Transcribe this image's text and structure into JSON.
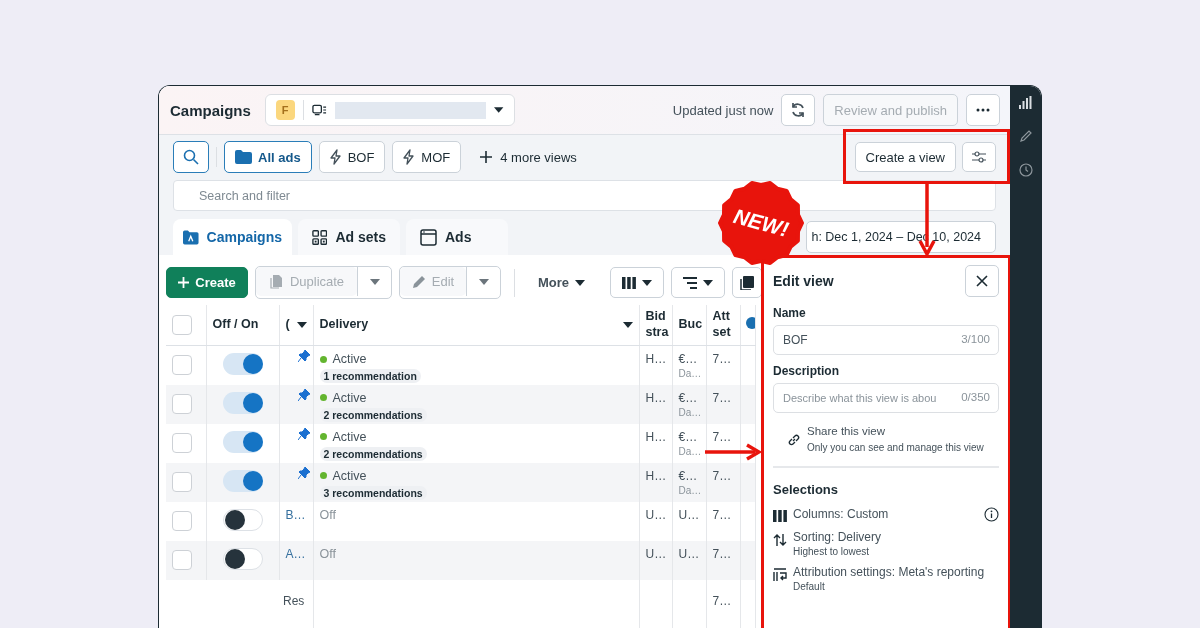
{
  "header": {
    "title": "Campaigns",
    "account_badge": "F",
    "updated": "Updated just now",
    "publish": {
      "label": "Review and publish",
      "disabled": true
    }
  },
  "views": [
    {
      "label": "All ads",
      "kind": "folder",
      "selected": true
    },
    {
      "label": "BOF",
      "kind": "bolt",
      "selected": false
    },
    {
      "label": "MOF",
      "kind": "bolt",
      "selected": false
    }
  ],
  "more_views": "4 more views",
  "create_view": "Create a view",
  "search": {
    "placeholder": "Search and filter"
  },
  "tabs": [
    {
      "label": "Campaigns",
      "kind": "campaign",
      "selected": true
    },
    {
      "label": "Ad sets",
      "kind": "adset",
      "selected": false
    },
    {
      "label": "Ads",
      "kind": "ad",
      "selected": false
    }
  ],
  "date_range": "h: Dec 1, 2024 – Dec 10, 2024",
  "toolbar": {
    "create": "Create",
    "duplicate": {
      "label": "Duplicate",
      "disabled": true
    },
    "edit": {
      "label": "Edit",
      "disabled": true
    },
    "more": "More"
  },
  "table": {
    "select_all_checked": false,
    "columns": [
      "Off / On",
      "(",
      "Delivery",
      "Bid stra",
      "Buc",
      "Att set"
    ],
    "rows": [
      {
        "checked": false,
        "on": true,
        "pinned": true,
        "delivery": "Active",
        "active": true,
        "recommendations": "1 recommendation",
        "bid": "H…",
        "budget": "€…",
        "budget_note": "Da…",
        "attribution": "7…"
      },
      {
        "checked": false,
        "on": true,
        "pinned": true,
        "delivery": "Active",
        "active": true,
        "recommendations": "2 recommendations",
        "bid": "H…",
        "budget": "€…",
        "budget_note": "Da…",
        "attribution": "7…"
      },
      {
        "checked": false,
        "on": true,
        "pinned": true,
        "delivery": "Active",
        "active": true,
        "recommendations": "2 recommendations",
        "bid": "H…",
        "budget": "€…",
        "budget_note": "Da…",
        "attribution": "7…"
      },
      {
        "checked": false,
        "on": true,
        "pinned": true,
        "delivery": "Active",
        "active": true,
        "recommendations": "3 recommendations",
        "bid": "H…",
        "budget": "€…",
        "budget_note": "Da…",
        "attribution": "7…"
      },
      {
        "checked": false,
        "on": false,
        "pinned": false,
        "name": "B…",
        "delivery": "Off",
        "active": false,
        "bid": "U…",
        "budget": "U…",
        "attribution": "7…"
      },
      {
        "checked": false,
        "on": false,
        "pinned": false,
        "name": "A…",
        "delivery": "Off",
        "active": false,
        "bid": "U…",
        "budget": "U…",
        "attribution": "7…"
      }
    ],
    "results_row": {
      "label": "Res",
      "attribution": "7…"
    }
  },
  "edit_view": {
    "title": "Edit view",
    "name_label": "Name",
    "name_value": "BOF",
    "name_count": "3/100",
    "description_label": "Description",
    "description_placeholder": "Describe what this view is abou",
    "description_count": "0/350",
    "share_title": "Share this view",
    "share_note": "Only you can see and manage this view",
    "selections_title": "Selections",
    "selections": [
      {
        "kind": "columns",
        "title": "Columns: Custom",
        "info": true
      },
      {
        "kind": "sorting",
        "title": "Sorting: Delivery",
        "note": "Highest to lowest",
        "info": false
      },
      {
        "kind": "attribution",
        "title": "Attribution settings: Meta's reporting",
        "note": "Default",
        "info": false
      }
    ]
  },
  "annotation": {
    "badge": "NEW!"
  }
}
